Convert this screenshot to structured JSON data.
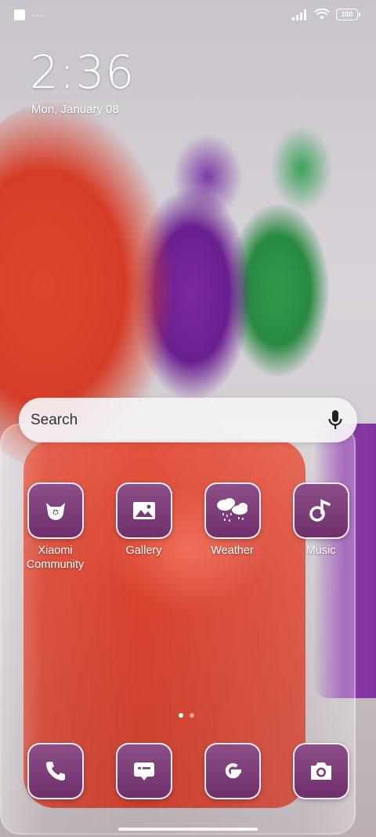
{
  "status_bar": {
    "notification_icons": [
      "square-icon",
      "more-dots-icon"
    ],
    "more_indicator": "···",
    "battery_level": "100"
  },
  "lockscreen": {
    "time": "2:36",
    "date": "Mon, January 08"
  },
  "search": {
    "placeholder": "Search",
    "mic_icon": "microphone-icon"
  },
  "apps": [
    {
      "label": "Xiaomi Community",
      "icon": "xiaomi-community-icon"
    },
    {
      "label": "Gallery",
      "icon": "gallery-icon"
    },
    {
      "label": "Weather",
      "icon": "weather-icon"
    },
    {
      "label": "Music",
      "icon": "music-icon"
    }
  ],
  "dock": [
    {
      "name": "Phone",
      "icon": "phone-icon"
    },
    {
      "name": "Messages",
      "icon": "messages-icon"
    },
    {
      "name": "Google",
      "icon": "google-icon"
    },
    {
      "name": "Camera",
      "icon": "camera-icon"
    }
  ],
  "pages": {
    "count": 2,
    "current": 1
  },
  "theme": {
    "icon_color": "#7a3b76",
    "icon_border": "#ffffff"
  }
}
